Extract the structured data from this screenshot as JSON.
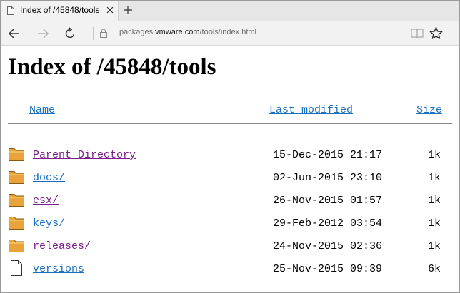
{
  "browser": {
    "tab_title": "Index of /45848/tools",
    "url_prefix": "packages.",
    "url_host": "vmware.com",
    "url_path": "/tools/index.html"
  },
  "page": {
    "heading": "Index of /45848/tools",
    "columns": {
      "name": "Name",
      "last_modified": "Last modified",
      "size": "Size"
    },
    "rows": [
      {
        "name": "Parent Directory",
        "date": "15-Dec-2015 21:17",
        "size": "1k",
        "icon": "folder-icon",
        "visited": true
      },
      {
        "name": "docs/",
        "date": "02-Jun-2015 23:10",
        "size": "1k",
        "icon": "folder-icon",
        "visited": false
      },
      {
        "name": "esx/",
        "date": "26-Nov-2015 01:57",
        "size": "1k",
        "icon": "folder-icon",
        "visited": true
      },
      {
        "name": "keys/",
        "date": "29-Feb-2012 03:54",
        "size": "1k",
        "icon": "folder-icon",
        "visited": false
      },
      {
        "name": "releases/",
        "date": "24-Nov-2015 02:36",
        "size": "1k",
        "icon": "folder-icon",
        "visited": true
      },
      {
        "name": "versions",
        "date": "25-Nov-2015 09:39",
        "size": "6k",
        "icon": "file-icon",
        "visited": false
      }
    ]
  },
  "colors": {
    "link": "#1a6fc0",
    "visited": "#7b1f8c",
    "folder": "#e8a33d"
  }
}
